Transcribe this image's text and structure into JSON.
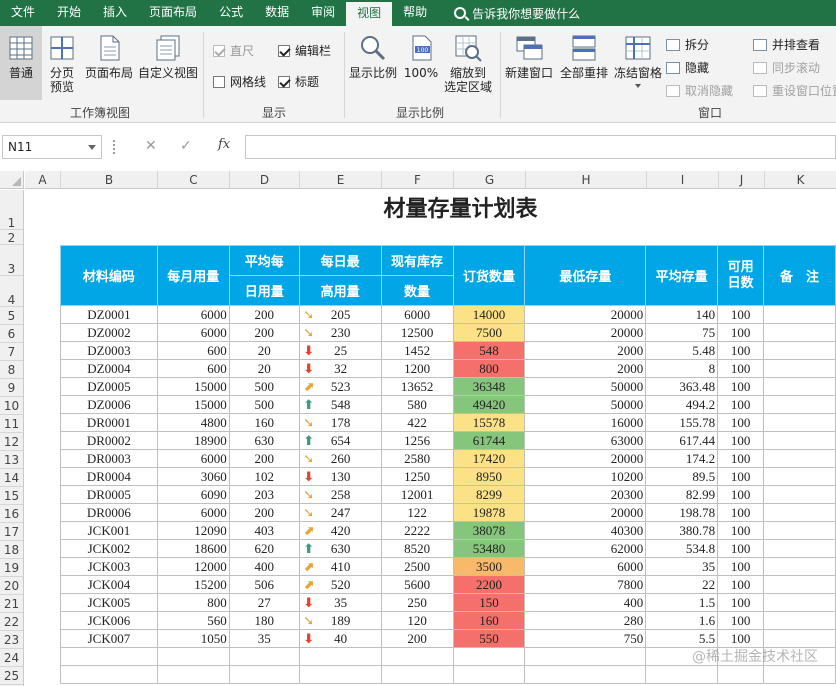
{
  "ribbon_tabs": [
    "文件",
    "开始",
    "插入",
    "页面布局",
    "公式",
    "数据",
    "审阅",
    "视图",
    "帮助"
  ],
  "active_tab": "视图",
  "tell_me": "告诉我你想要做什么",
  "ribbon": {
    "workbook_views": {
      "label": "工作簿视图",
      "normal": "普通",
      "page_break_1": "分页",
      "page_break_2": "预览",
      "page_layout": "页面布局",
      "custom_views": "自定义视图"
    },
    "show": {
      "label": "显示",
      "ruler": "直尺",
      "formula_bar": "编辑栏",
      "gridlines": "网格线",
      "headings": "标题"
    },
    "zoom": {
      "label": "显示比例",
      "zoom": "显示比例",
      "zoom100": "100%",
      "zoom_sel_1": "缩放到",
      "zoom_sel_2": "选定区域"
    },
    "window": {
      "label": "窗口",
      "new_window": "新建窗口",
      "arrange_all": "全部重排",
      "freeze": "冻结窗格",
      "split": "拆分",
      "hide": "隐藏",
      "unhide": "取消隐藏",
      "side_by_side": "并排查看",
      "sync_scroll": "同步滚动",
      "reset_pos": "重设窗口位置"
    }
  },
  "formula_bar": {
    "name_box": "N11",
    "cancel": "✕",
    "enter": "✓",
    "fx": "fx",
    "value": ""
  },
  "columns": [
    "A",
    "B",
    "C",
    "D",
    "E",
    "F",
    "G",
    "H",
    "I",
    "J",
    "K"
  ],
  "rows": [
    "1",
    "2",
    "3",
    "4",
    "5",
    "6",
    "7",
    "8",
    "9",
    "10",
    "11",
    "12",
    "13",
    "14",
    "15",
    "16",
    "17",
    "18",
    "19",
    "20",
    "21",
    "22",
    "23",
    "24",
    "25"
  ],
  "sheet_title": "材量存量计划表",
  "headers": {
    "code": "材料编码",
    "monthly": "每月用量",
    "avg_daily_1": "平均每",
    "avg_daily_2": "日用量",
    "max_daily_1": "每日最",
    "max_daily_2": "高用量",
    "stock_1": "现有库存",
    "stock_2": "数量",
    "order": "订货数量",
    "min_stock": "最低存量",
    "avg_stock": "平均存量",
    "days_1": "可用",
    "days_2": "日数",
    "note": "备　注"
  },
  "icon_colors": {
    "up": "#3d9b77",
    "up_right": "#e8a43a",
    "side": "#e8a43a",
    "down": "#e0462c",
    "order_green": "#86c67c",
    "order_yellow": "#fbe286",
    "order_orange": "#f8b96a",
    "order_red": "#f56f6b"
  },
  "table_rows": [
    {
      "code": "DZ0001",
      "monthly": "6000",
      "avg": "200",
      "arrow": "side",
      "max": "205",
      "stock": "6000",
      "order": "14000",
      "color": "order_yellow",
      "min": "20000",
      "avg_stock": "140",
      "days": "100"
    },
    {
      "code": "DZ0002",
      "monthly": "6000",
      "avg": "200",
      "arrow": "side",
      "max": "230",
      "stock": "12500",
      "order": "7500",
      "color": "order_yellow",
      "min": "20000",
      "avg_stock": "75",
      "days": "100"
    },
    {
      "code": "DZ0003",
      "monthly": "600",
      "avg": "20",
      "arrow": "down",
      "max": "25",
      "stock": "1452",
      "order": "548",
      "color": "order_red",
      "min": "2000",
      "avg_stock": "5.48",
      "days": "100"
    },
    {
      "code": "DZ0004",
      "monthly": "600",
      "avg": "20",
      "arrow": "down",
      "max": "32",
      "stock": "1200",
      "order": "800",
      "color": "order_red",
      "min": "2000",
      "avg_stock": "8",
      "days": "100"
    },
    {
      "code": "DZ0005",
      "monthly": "15000",
      "avg": "500",
      "arrow": "up_right",
      "max": "523",
      "stock": "13652",
      "order": "36348",
      "color": "order_green",
      "min": "50000",
      "avg_stock": "363.48",
      "days": "100"
    },
    {
      "code": "DZ0006",
      "monthly": "15000",
      "avg": "500",
      "arrow": "up",
      "max": "548",
      "stock": "580",
      "order": "49420",
      "color": "order_green",
      "min": "50000",
      "avg_stock": "494.2",
      "days": "100"
    },
    {
      "code": "DR0001",
      "monthly": "4800",
      "avg": "160",
      "arrow": "side",
      "max": "178",
      "stock": "422",
      "order": "15578",
      "color": "order_yellow",
      "min": "16000",
      "avg_stock": "155.78",
      "days": "100"
    },
    {
      "code": "DR0002",
      "monthly": "18900",
      "avg": "630",
      "arrow": "up",
      "max": "654",
      "stock": "1256",
      "order": "61744",
      "color": "order_green",
      "min": "63000",
      "avg_stock": "617.44",
      "days": "100"
    },
    {
      "code": "DR0003",
      "monthly": "6000",
      "avg": "200",
      "arrow": "side",
      "max": "260",
      "stock": "2580",
      "order": "17420",
      "color": "order_yellow",
      "min": "20000",
      "avg_stock": "174.2",
      "days": "100"
    },
    {
      "code": "DR0004",
      "monthly": "3060",
      "avg": "102",
      "arrow": "down",
      "max": "130",
      "stock": "1250",
      "order": "8950",
      "color": "order_yellow",
      "min": "10200",
      "avg_stock": "89.5",
      "days": "100"
    },
    {
      "code": "DR0005",
      "monthly": "6090",
      "avg": "203",
      "arrow": "side",
      "max": "258",
      "stock": "12001",
      "order": "8299",
      "color": "order_yellow",
      "min": "20300",
      "avg_stock": "82.99",
      "days": "100"
    },
    {
      "code": "DR0006",
      "monthly": "6000",
      "avg": "200",
      "arrow": "side",
      "max": "247",
      "stock": "122",
      "order": "19878",
      "color": "order_yellow",
      "min": "20000",
      "avg_stock": "198.78",
      "days": "100"
    },
    {
      "code": "JCK001",
      "monthly": "12090",
      "avg": "403",
      "arrow": "up_right",
      "max": "420",
      "stock": "2222",
      "order": "38078",
      "color": "order_green",
      "min": "40300",
      "avg_stock": "380.78",
      "days": "100"
    },
    {
      "code": "JCK002",
      "monthly": "18600",
      "avg": "620",
      "arrow": "up",
      "max": "630",
      "stock": "8520",
      "order": "53480",
      "color": "order_green",
      "min": "62000",
      "avg_stock": "534.8",
      "days": "100"
    },
    {
      "code": "JCK003",
      "monthly": "12000",
      "avg": "400",
      "arrow": "up_right",
      "max": "410",
      "stock": "2500",
      "order": "3500",
      "color": "order_orange",
      "min": "6000",
      "avg_stock": "35",
      "days": "100"
    },
    {
      "code": "JCK004",
      "monthly": "15200",
      "avg": "506",
      "arrow": "up_right",
      "max": "520",
      "stock": "5600",
      "order": "2200",
      "color": "order_red",
      "min": "7800",
      "avg_stock": "22",
      "days": "100"
    },
    {
      "code": "JCK005",
      "monthly": "800",
      "avg": "27",
      "arrow": "down",
      "max": "35",
      "stock": "250",
      "order": "150",
      "color": "order_red",
      "min": "400",
      "avg_stock": "1.5",
      "days": "100"
    },
    {
      "code": "JCK006",
      "monthly": "560",
      "avg": "180",
      "arrow": "side",
      "max": "189",
      "stock": "120",
      "order": "160",
      "color": "order_red",
      "min": "280",
      "avg_stock": "1.6",
      "days": "100"
    },
    {
      "code": "JCK007",
      "monthly": "1050",
      "avg": "35",
      "arrow": "down",
      "max": "40",
      "stock": "200",
      "order": "550",
      "color": "order_red",
      "min": "750",
      "avg_stock": "5.5",
      "days": "100"
    }
  ],
  "watermark": "@稀土掘金技术社区"
}
